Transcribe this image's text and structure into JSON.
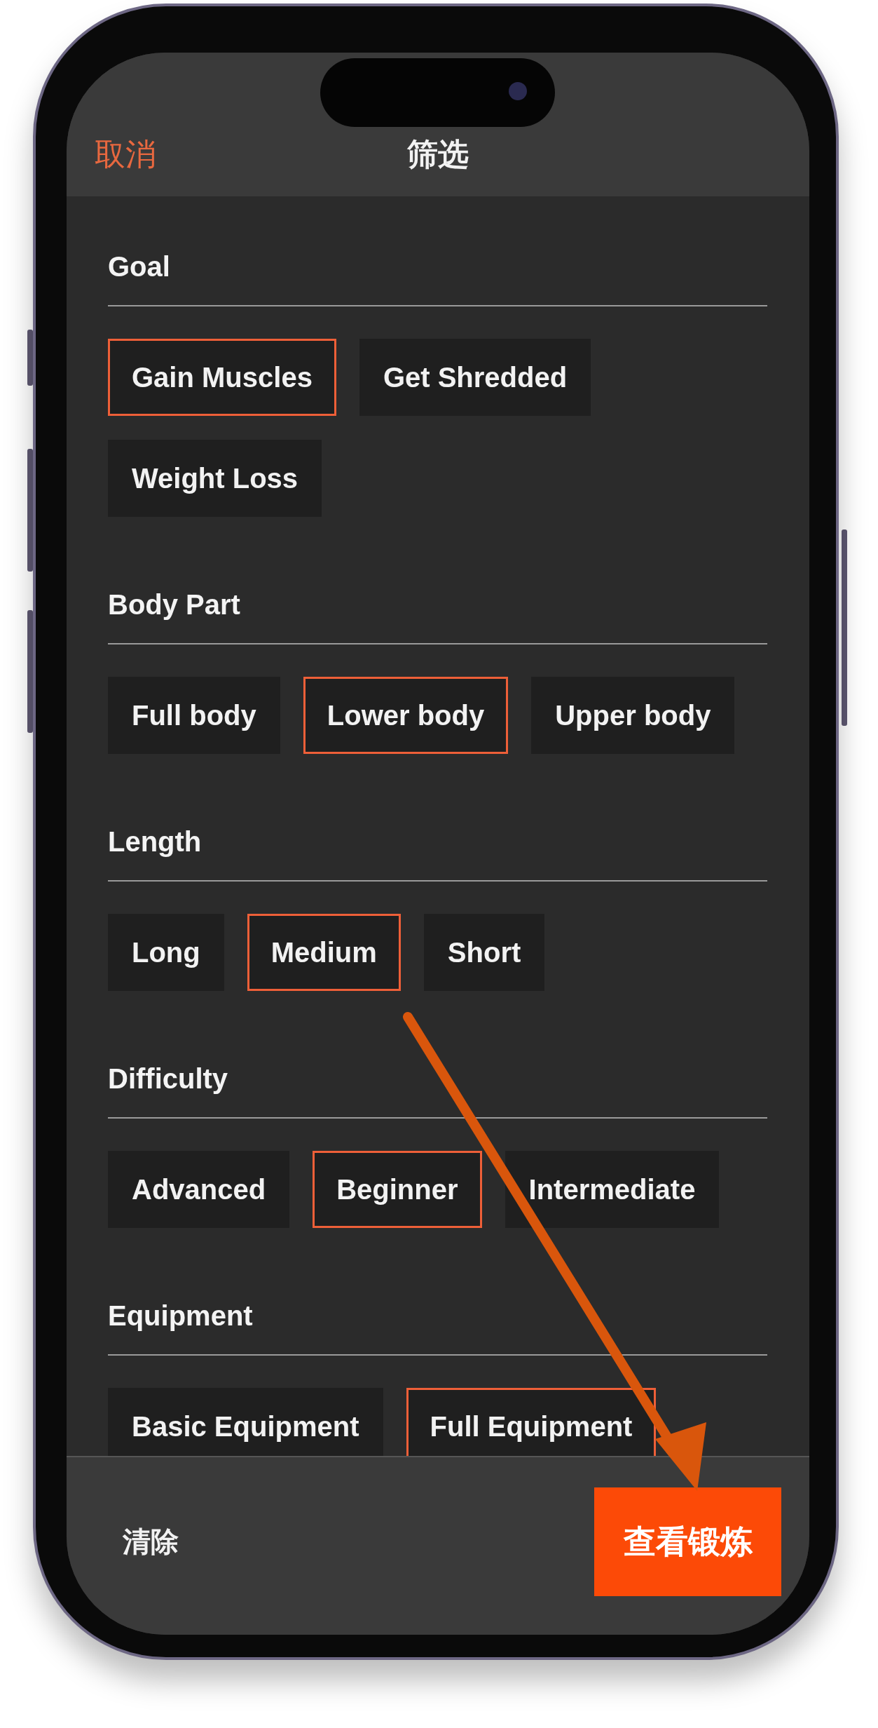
{
  "header": {
    "cancel": "取消",
    "title": "筛选"
  },
  "sections": [
    {
      "title": "Goal",
      "options": [
        {
          "label": "Gain Muscles",
          "selected": true
        },
        {
          "label": "Get Shredded",
          "selected": false
        },
        {
          "label": "Weight Loss",
          "selected": false
        }
      ]
    },
    {
      "title": "Body Part",
      "options": [
        {
          "label": "Full body",
          "selected": false
        },
        {
          "label": "Lower body",
          "selected": true
        },
        {
          "label": "Upper body",
          "selected": false
        }
      ]
    },
    {
      "title": "Length",
      "options": [
        {
          "label": "Long",
          "selected": false
        },
        {
          "label": "Medium",
          "selected": true
        },
        {
          "label": "Short",
          "selected": false
        }
      ]
    },
    {
      "title": "Difficulty",
      "options": [
        {
          "label": "Advanced",
          "selected": false
        },
        {
          "label": "Beginner",
          "selected": true
        },
        {
          "label": "Intermediate",
          "selected": false
        }
      ]
    },
    {
      "title": "Equipment",
      "options": [
        {
          "label": "Basic Equipment",
          "selected": false
        },
        {
          "label": "Full Equipment",
          "selected": true
        }
      ]
    }
  ],
  "footer": {
    "clear": "清除",
    "submit": "查看锻炼"
  }
}
